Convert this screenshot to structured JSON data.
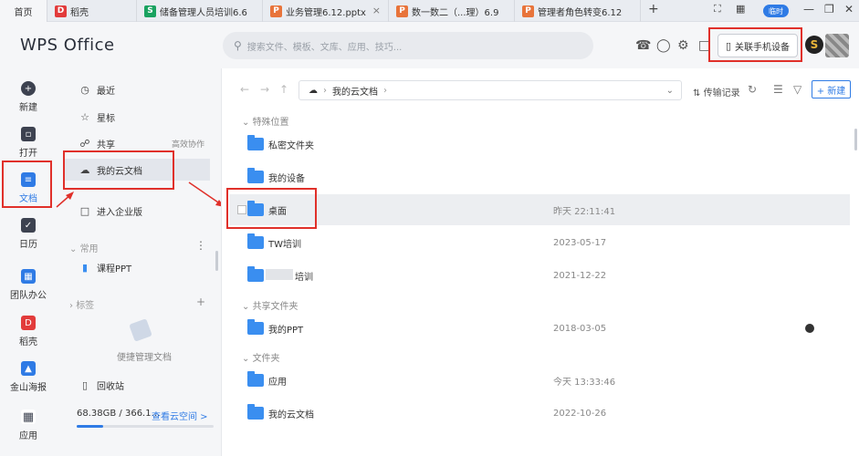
{
  "tabs": [
    {
      "label": "首页",
      "icon": "",
      "color": ""
    },
    {
      "label": "稻壳",
      "icon": "docer-icon",
      "color": "#e23b3b"
    },
    {
      "label": "储备管理人员培训6.6",
      "icon": "spreadsheet-icon",
      "color": "#1aa260"
    },
    {
      "label": "业务管理6.12.pptx",
      "icon": "presentation-icon",
      "color": "#e8743b"
    },
    {
      "label": "数一数二（...理）6.9",
      "icon": "presentation-icon",
      "color": "#e8743b"
    },
    {
      "label": "管理者角色转变6.12",
      "icon": "presentation-icon",
      "color": "#e8743b"
    }
  ],
  "tab_glyphs": {
    "docer": "D",
    "sheet": "S",
    "ppt": "P",
    "add": "+",
    "close": "×"
  },
  "window": {
    "badge": "临时",
    "btn_fullscreen": "⛶",
    "btn_grid": "▦",
    "btn_min": "—",
    "btn_restore": "❐",
    "btn_close": "✕"
  },
  "app": {
    "logo": "WPS Office"
  },
  "search": {
    "placeholder": "搜索文件、模板、文库、应用、技巧..."
  },
  "header": {
    "phone_button": "关联手机设备",
    "avatar_letter": "S"
  },
  "left_rail": [
    {
      "label": "新建",
      "icon": "plus-icon"
    },
    {
      "label": "打开",
      "icon": "folder-open-icon"
    },
    {
      "label": "文档",
      "icon": "document-icon"
    },
    {
      "label": "日历",
      "icon": "calendar-icon"
    },
    {
      "label": "团队办公",
      "icon": "team-icon"
    },
    {
      "label": "稻壳",
      "icon": "docer-icon"
    },
    {
      "label": "金山海报",
      "icon": "poster-icon"
    },
    {
      "label": "应用",
      "icon": "apps-icon"
    }
  ],
  "nav": {
    "recent": "最近",
    "starred": "星标",
    "shared": "共享",
    "shared_extra": "高效协作",
    "cloud": "我的云文档",
    "enterprise": "进入企业版",
    "common_header": "常用",
    "course_ppt": "课程PPT",
    "tags_header": "标签",
    "convenient": "便捷管理文档",
    "recycle": "回收站",
    "storage": "68.38GB / 366.1...",
    "view_space": "查看云空间 >"
  },
  "toolbar": {
    "path": "我的云文档",
    "transfer": "传输记录",
    "new": "+ 新建"
  },
  "groups": {
    "special": "特殊位置",
    "shared_folders": "共享文件夹",
    "folders": "文件夹"
  },
  "files": [
    {
      "name": "私密文件夹",
      "date": ""
    },
    {
      "name": "我的设备",
      "date": ""
    },
    {
      "name": "桌面",
      "date": "昨天 22:11:41"
    },
    {
      "name": "TW培训",
      "date": "2023-05-17"
    },
    {
      "name": "培训",
      "date": "2021-12-22"
    },
    {
      "name": "我的PPT",
      "date": "2018-03-05"
    },
    {
      "name": "应用",
      "date": "今天 13:33:46"
    },
    {
      "name": "我的云文档",
      "date": "2022-10-26"
    }
  ]
}
